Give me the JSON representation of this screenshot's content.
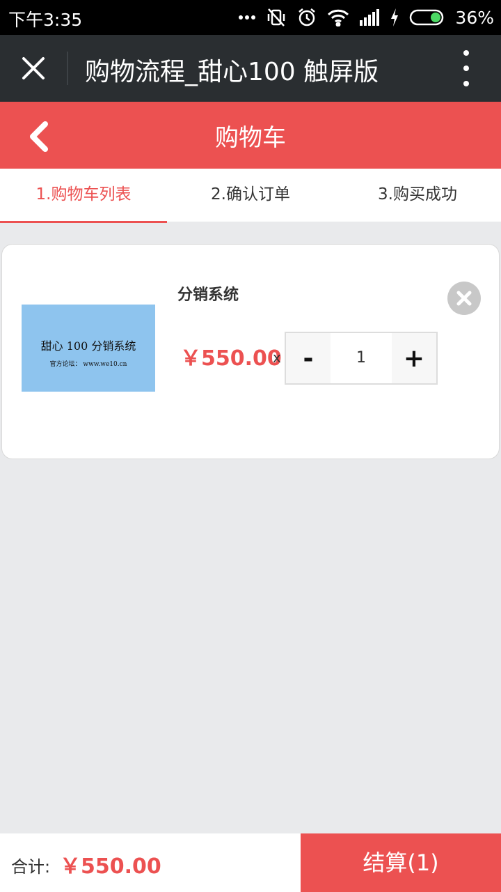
{
  "status_bar": {
    "time": "下午3:35",
    "battery_percent": "36%",
    "icons": [
      "more-dots-icon",
      "vibrate-off-icon",
      "alarm-icon",
      "wifi-icon",
      "signal-icon",
      "charging-icon",
      "battery-icon"
    ]
  },
  "browser_bar": {
    "title": "购物流程_甜心100 触屏版",
    "icons": [
      "close-icon",
      "more-vertical-icon"
    ]
  },
  "header": {
    "title": "购物车",
    "back_icon": "chevron-left-icon"
  },
  "steps": [
    {
      "label": "1.购物车列表",
      "active": true
    },
    {
      "label": "2.确认订单",
      "active": false
    },
    {
      "label": "3.购买成功",
      "active": false
    }
  ],
  "cart": {
    "items": [
      {
        "name": "分销系统",
        "thumbnail_title": "甜心 100 分销系统",
        "thumbnail_subtitle": "官方论坛： www.we10.cn",
        "price": "￥550.00",
        "times": "x",
        "quantity": "1",
        "minus_label": "-",
        "plus_label": "+"
      }
    ]
  },
  "footer": {
    "total_label": "合计:",
    "total_value": "￥550.00",
    "checkout_label": "结算(1)"
  },
  "colors": {
    "accent": "#ec5151",
    "browser_bar": "#2a2e31",
    "background": "#e9eaec",
    "thumbnail": "#8ec4ee"
  }
}
